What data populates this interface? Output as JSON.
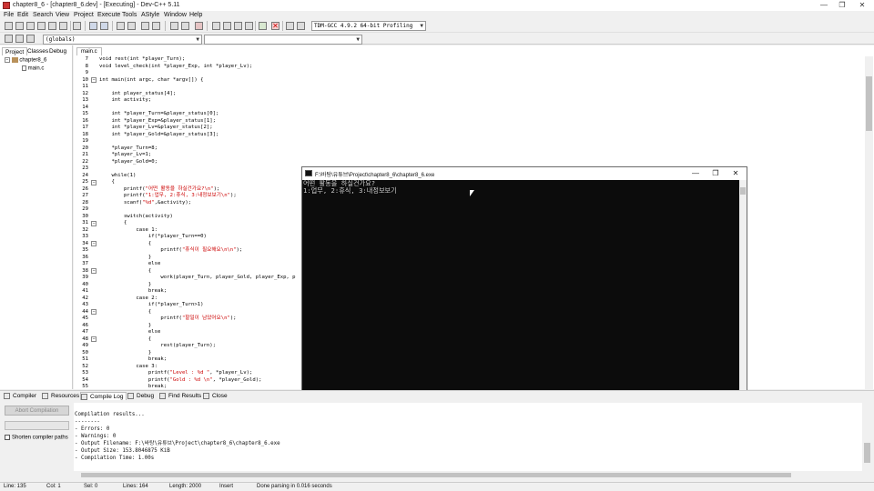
{
  "window": {
    "title": "chapter8_6 - [chapter8_6.dev] - [Executing] - Dev-C++ 5.11",
    "minimize": "—",
    "maximize": "❐",
    "close": "✕"
  },
  "menu": [
    "File",
    "Edit",
    "Search",
    "View",
    "Project",
    "Execute",
    "Tools",
    "AStyle",
    "Window",
    "Help"
  ],
  "toolbar": {
    "compiler_select": "TDM-GCC 4.9.2 64-bit Profiling",
    "scope_select": "(globals)",
    "member_select": ""
  },
  "left_panel": {
    "tabs": [
      "Project",
      "Classes",
      "Debug"
    ],
    "tree": {
      "project": "chapter8_6",
      "file": "main.c"
    }
  },
  "editor": {
    "tab": "main.c",
    "lines": [
      {
        "n": "7",
        "fold": "",
        "code": "void rest(int *player_Turn);"
      },
      {
        "n": "8",
        "fold": "",
        "code": "void level_check(int *player_Exp, int *player_Lv);"
      },
      {
        "n": "9",
        "fold": "",
        "code": ""
      },
      {
        "n": "10",
        "fold": "−",
        "code": "int main(int argc, char *argv[]) {"
      },
      {
        "n": "11",
        "fold": "",
        "code": ""
      },
      {
        "n": "12",
        "fold": "",
        "code": "    int player_status[4];"
      },
      {
        "n": "13",
        "fold": "",
        "code": "    int activity;"
      },
      {
        "n": "14",
        "fold": "",
        "code": ""
      },
      {
        "n": "15",
        "fold": "",
        "code": "    int *player_Turn=&player_status[0];"
      },
      {
        "n": "16",
        "fold": "",
        "code": "    int *player_Exp=&player_status[1];"
      },
      {
        "n": "17",
        "fold": "",
        "code": "    int *player_Lv=&player_status[2];"
      },
      {
        "n": "18",
        "fold": "",
        "code": "    int *player_Gold=&player_status[3];"
      },
      {
        "n": "19",
        "fold": "",
        "code": ""
      },
      {
        "n": "20",
        "fold": "",
        "code": "    *player_Turn=8;"
      },
      {
        "n": "21",
        "fold": "",
        "code": "    *player_Lv=1;"
      },
      {
        "n": "22",
        "fold": "",
        "code": "    *player_Gold=0;"
      },
      {
        "n": "23",
        "fold": "",
        "code": ""
      },
      {
        "n": "24",
        "fold": "",
        "code": "    while(1)"
      },
      {
        "n": "25",
        "fold": "−",
        "code": "    {"
      },
      {
        "n": "26",
        "fold": "",
        "code": "        printf(\"어떤 활동을 하실건가요?\\n\");"
      },
      {
        "n": "27",
        "fold": "",
        "code": "        printf(\"1:업무, 2:휴식, 3:내정보보기\\n\");"
      },
      {
        "n": "28",
        "fold": "",
        "code": "        scanf(\"%d\",&activity);"
      },
      {
        "n": "29",
        "fold": "",
        "code": ""
      },
      {
        "n": "30",
        "fold": "",
        "code": "        switch(activity)"
      },
      {
        "n": "31",
        "fold": "−",
        "code": "        {"
      },
      {
        "n": "32",
        "fold": "",
        "code": "            case 1:"
      },
      {
        "n": "33",
        "fold": "",
        "code": "                if(*player_Turn==0)"
      },
      {
        "n": "34",
        "fold": "−",
        "code": "                {"
      },
      {
        "n": "35",
        "fold": "",
        "code": "                    printf(\"휴식이 필요해요\\n\\n\");"
      },
      {
        "n": "36",
        "fold": "",
        "code": "                }"
      },
      {
        "n": "37",
        "fold": "",
        "code": "                else"
      },
      {
        "n": "38",
        "fold": "−",
        "code": "                {"
      },
      {
        "n": "39",
        "fold": "",
        "code": "                    work(player_Turn, player_Gold, player_Exp, p"
      },
      {
        "n": "40",
        "fold": "",
        "code": "                }"
      },
      {
        "n": "41",
        "fold": "",
        "code": "                break;"
      },
      {
        "n": "42",
        "fold": "",
        "code": "            case 2:"
      },
      {
        "n": "43",
        "fold": "",
        "code": "                if(*player_Turn>1)"
      },
      {
        "n": "44",
        "fold": "−",
        "code": "                {"
      },
      {
        "n": "45",
        "fold": "",
        "code": "                    printf(\"할일이 남았어요\\n\");"
      },
      {
        "n": "46",
        "fold": "",
        "code": "                }"
      },
      {
        "n": "47",
        "fold": "",
        "code": "                else"
      },
      {
        "n": "48",
        "fold": "−",
        "code": "                {"
      },
      {
        "n": "49",
        "fold": "",
        "code": "                    rest(player_Turn);"
      },
      {
        "n": "50",
        "fold": "",
        "code": "                }"
      },
      {
        "n": "51",
        "fold": "",
        "code": "                break;"
      },
      {
        "n": "52",
        "fold": "",
        "code": "            case 3:"
      },
      {
        "n": "53",
        "fold": "",
        "code": "                printf(\"Level : %d \", *player_Lv);"
      },
      {
        "n": "54",
        "fold": "",
        "code": "                printf(\"Gold : %d \\n\", *player_Gold);"
      },
      {
        "n": "55",
        "fold": "",
        "code": "                break;"
      }
    ]
  },
  "console": {
    "title": "F:\\바탕\\유튜브\\Project\\chapter8_6\\chapter8_6.exe",
    "lines": [
      "어떤 활동을 하실건가요?",
      "1:업무, 2:휴식, 3:내정보보기"
    ]
  },
  "bottom_tabs": [
    "Compiler",
    "Resources",
    "Compile Log",
    "Debug",
    "Find Results",
    "Close"
  ],
  "bottom_left": {
    "abort": "Abort Compilation",
    "shorten": "Shorten compiler paths"
  },
  "log": {
    "lines": [
      "Compilation results...",
      "--------",
      "- Errors: 0",
      "- Warnings: 0",
      "- Output Filename: F:\\바탕\\유튜브\\Project\\chapter8_6\\chapter8_6.exe",
      "- Output Size: 153.8046875 KiB",
      "- Compilation Time: 1.00s"
    ]
  },
  "status": {
    "line": "Line:   135",
    "col": "Col:    1",
    "sel": "Sel:    0",
    "lines": "Lines:   164",
    "length": "Length:  2000",
    "mode": "Insert",
    "message": "Done parsing in 0.016 seconds"
  }
}
